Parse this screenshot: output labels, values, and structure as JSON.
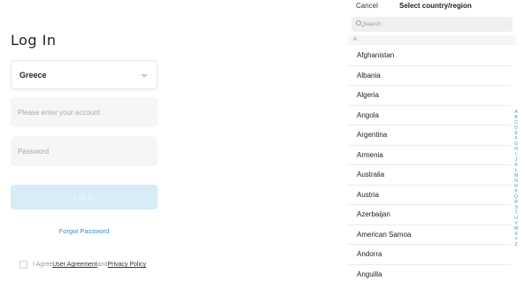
{
  "login": {
    "title": "Log In",
    "country_value": "Greece",
    "account_placeholder": "Please enter your account",
    "password_placeholder": "Password",
    "login_button": "Log In",
    "forgot_password": "Forgot Password",
    "agree_prefix": "I Agree",
    "user_agreement": "User Agreement",
    "and_text": "and",
    "privacy_policy": "Privacy Policy"
  },
  "picker": {
    "cancel": "Cancel",
    "title": "Select country/region",
    "search_placeholder": "Search",
    "section_letter": "A",
    "countries": [
      "Afghanistan",
      "Albania",
      "Algeria",
      "Angola",
      "Argentina",
      "Armenia",
      "Australia",
      "Austria",
      "Azerbaijan",
      "American Samoa",
      "Andorra",
      "Anguilla"
    ],
    "index_letters": [
      "A",
      "B",
      "C",
      "D",
      "E",
      "F",
      "G",
      "H",
      "I",
      "J",
      "K",
      "L",
      "M",
      "N",
      "O",
      "P",
      "Q",
      "R",
      "S",
      "T",
      "U",
      "V",
      "W",
      "X",
      "Y",
      "Z"
    ]
  },
  "colors": {
    "accent": "#3b8ed0",
    "login_button_disabled": "#d7ecf6",
    "field_bg": "#f6f6f6"
  }
}
